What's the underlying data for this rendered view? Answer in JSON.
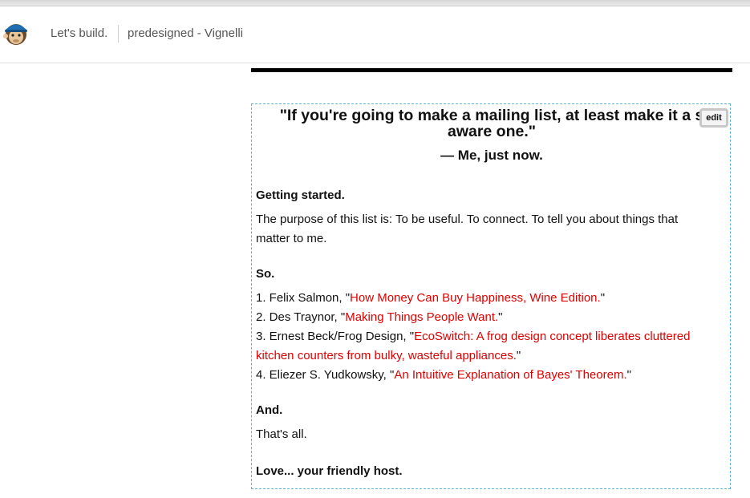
{
  "header": {
    "title": "Let's build.",
    "campaign": "predesigned - Vignelli",
    "logo_icon": "monkey-logo-icon"
  },
  "content": {
    "quote_line1": "\"If you're going to make a mailing list, at least make it a s",
    "quote_line2": "aware one.\"",
    "attribution": "— Me, just now.",
    "edit_label": "edit",
    "getting_started": "Getting started.",
    "purpose_line1": "The purpose of this list is: To be useful. To connect. To tell you about things that",
    "purpose_line2": "matter to me.",
    "so": "So.",
    "items": [
      {
        "prefix": "1. Felix Salmon, \"",
        "link": "How Money Can Buy Happiness, Wine Edition.",
        "suffix": "\""
      },
      {
        "prefix": "2. Des Traynor, \"",
        "link": "Making Things People Want.",
        "suffix": "\""
      },
      {
        "prefix": "3. Ernest  Beck/Frog Design, \"",
        "link": "EcoSwitch: A frog design concept liberates cluttered",
        "suffix": ""
      },
      {
        "prefix": "",
        "link": "kitchen counters from bulky, wasteful appliances.",
        "suffix": "\""
      },
      {
        "prefix": "4. Eliezer S. Yudkowsky, \"",
        "link": "An Intuitive Explanation of Bayes' Theorem.",
        "suffix": "\""
      }
    ],
    "and": "And.",
    "thats_all": "That's all.",
    "signoff": "Love... your friendly host."
  },
  "colors": {
    "link": "#e10000",
    "border": "#5fb3d9"
  }
}
